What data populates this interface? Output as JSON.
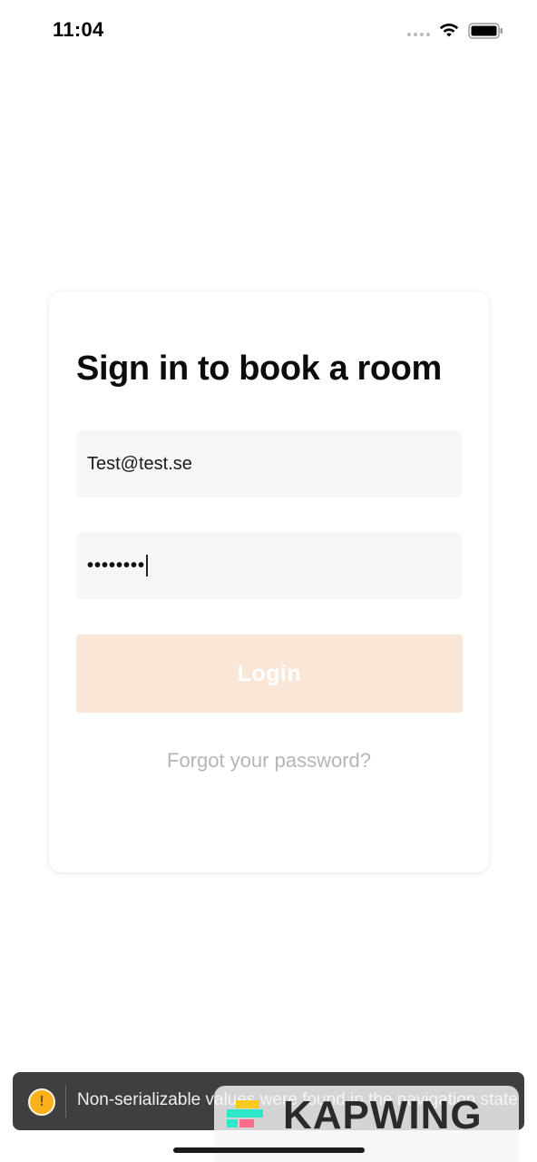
{
  "status_bar": {
    "time": "11:04"
  },
  "card": {
    "title": "Sign in to book a room",
    "email_value": "Test@test.se",
    "password_value": "••••••••",
    "login_label": "Login",
    "forgot_password_label": "Forgot your password?"
  },
  "toast": {
    "message": "Non-serializable values were found in the navigation state",
    "icon": "warning-icon"
  },
  "watermark": {
    "text": "KAPWING"
  },
  "colors": {
    "login_button_bg": "#f9e6d6",
    "field_bg": "#f6f6f6",
    "toast_bg": "#3f3f3f",
    "warning": "#fbb21a"
  }
}
